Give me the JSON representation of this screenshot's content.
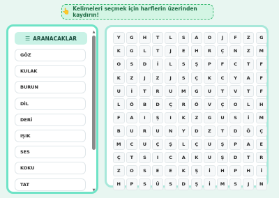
{
  "hint": {
    "icon": "hand-pointer-icon",
    "text": "Kelimeleri seçmek için harflerin üzerinden kaydırın!"
  },
  "words_panel": {
    "header_icon": "list-icon",
    "header_label": "ARANACAKLAR",
    "words": [
      "GÖZ",
      "KULAK",
      "BURUN",
      "DİL",
      "DERİ",
      "IŞIK",
      "SES",
      "KOKU",
      "TAT"
    ]
  },
  "grid": [
    [
      "Y",
      "G",
      "H",
      "T",
      "L",
      "S",
      "A",
      "O",
      "J",
      "F",
      "Z",
      "G"
    ],
    [
      "K",
      "G",
      "L",
      "T",
      "J",
      "E",
      "H",
      "R",
      "Ç",
      "N",
      "Z",
      "M"
    ],
    [
      "O",
      "S",
      "D",
      "İ",
      "L",
      "S",
      "Ş",
      "P",
      "F",
      "C",
      "T",
      "F"
    ],
    [
      "K",
      "Z",
      "J",
      "Z",
      "J",
      "S",
      "Ç",
      "K",
      "C",
      "Y",
      "A",
      "F"
    ],
    [
      "U",
      "İ",
      "T",
      "R",
      "U",
      "M",
      "G",
      "U",
      "T",
      "V",
      "T",
      "F"
    ],
    [
      "L",
      "Ö",
      "B",
      "D",
      "Ç",
      "R",
      "Ö",
      "V",
      "Ç",
      "O",
      "L",
      "H"
    ],
    [
      "F",
      "A",
      "I",
      "Ş",
      "I",
      "K",
      "Z",
      "G",
      "U",
      "S",
      "İ",
      "M"
    ],
    [
      "B",
      "U",
      "R",
      "U",
      "N",
      "Y",
      "D",
      "Z",
      "T",
      "D",
      "Ö",
      "Ç"
    ],
    [
      "M",
      "C",
      "U",
      "Ç",
      "Ş",
      "L",
      "Ç",
      "U",
      "Ş",
      "P",
      "A",
      "E"
    ],
    [
      "Ç",
      "T",
      "S",
      "I",
      "C",
      "A",
      "K",
      "U",
      "Ş",
      "D",
      "T",
      "R"
    ],
    [
      "Z",
      "O",
      "S",
      "E",
      "E",
      "K",
      "Ş",
      "İ",
      "H",
      "P",
      "H",
      "İ"
    ],
    [
      "H",
      "P",
      "S",
      "Ü",
      "S",
      "D",
      "Ş",
      "İ",
      "M",
      "S",
      "J",
      "N"
    ]
  ],
  "colors": {
    "accent": "#6ee3c6",
    "hint_bg": "#d3f5e4",
    "hint_border": "#35b86f"
  }
}
